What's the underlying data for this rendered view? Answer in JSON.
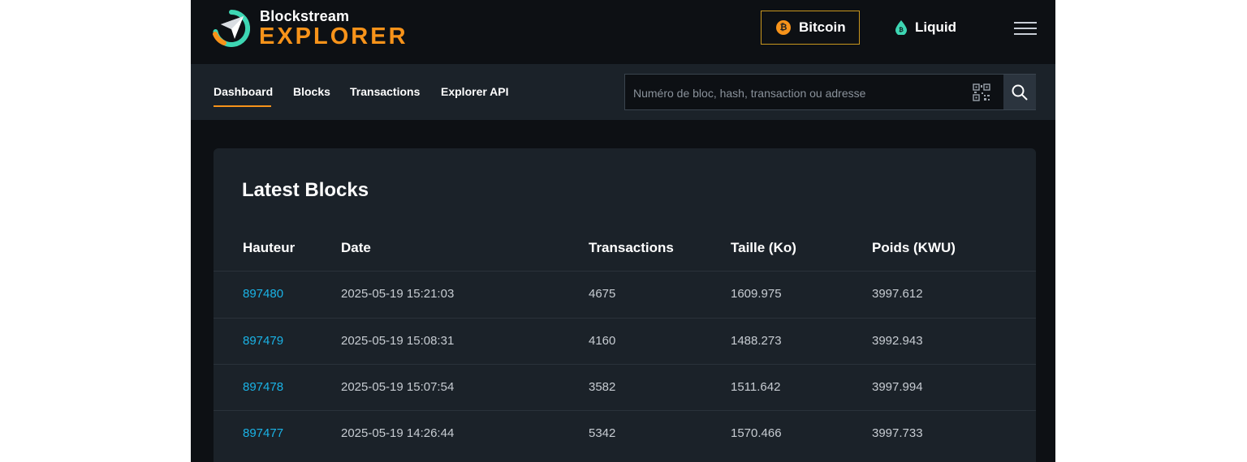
{
  "brand": {
    "line1": "Blockstream",
    "line2": "EXPLORER",
    "accent": "#f7931a",
    "mark_color": "#3dd6b3"
  },
  "networks": [
    {
      "label": "Bitcoin",
      "icon": "bitcoin-icon",
      "active": true
    },
    {
      "label": "Liquid",
      "icon": "liquid-drop-icon",
      "active": false
    }
  ],
  "nav": {
    "items": [
      {
        "label": "Dashboard",
        "active": true
      },
      {
        "label": "Blocks",
        "active": false
      },
      {
        "label": "Transactions",
        "active": false
      },
      {
        "label": "Explorer API",
        "active": false
      }
    ]
  },
  "search": {
    "placeholder": "Numéro de bloc, hash, transaction ou adresse",
    "value": ""
  },
  "latest_blocks": {
    "title": "Latest Blocks",
    "columns": [
      "Hauteur",
      "Date",
      "Transactions",
      "Taille (Ko)",
      "Poids (KWU)"
    ],
    "rows": [
      [
        "897480",
        "2025-05-19 15:21:03",
        "4675",
        "1609.975",
        "3997.612"
      ],
      [
        "897479",
        "2025-05-19 15:08:31",
        "4160",
        "1488.273",
        "3992.943"
      ],
      [
        "897478",
        "2025-05-19 15:07:54",
        "3582",
        "1511.642",
        "3997.994"
      ],
      [
        "897477",
        "2025-05-19 14:26:44",
        "5342",
        "1570.466",
        "3997.733"
      ]
    ]
  }
}
